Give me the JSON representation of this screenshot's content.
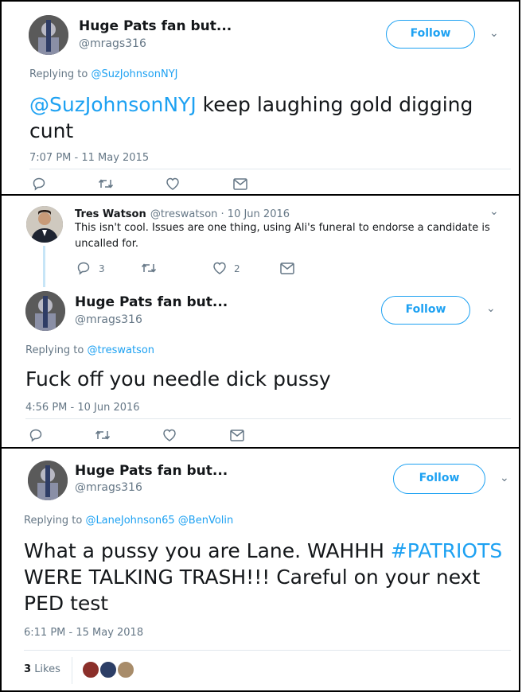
{
  "tweet1": {
    "user": {
      "name": "Huge Pats fan but...",
      "handle": "@mrags316"
    },
    "follow_label": "Follow",
    "reply_prefix": "Replying to",
    "reply_to": "@SuzJohnsonNYJ",
    "text_mention": "@SuzJohnsonNYJ",
    "text_rest": " keep laughing gold digging cunt",
    "timestamp": "7:07 PM - 11 May 2015"
  },
  "tweet2_parent": {
    "name": "Tres Watson",
    "handle_date": "@treswatson · 10 Jun 2016",
    "text": "This isn't cool. Issues are one thing, using Ali's funeral to endorse a candidate is uncalled for.",
    "reply_count": "3",
    "like_count": "2"
  },
  "tweet2": {
    "user": {
      "name": "Huge Pats fan but...",
      "handle": "@mrags316"
    },
    "follow_label": "Follow",
    "reply_prefix": "Replying to",
    "reply_to": "@treswatson",
    "text": "Fuck off you needle dick pussy",
    "timestamp": "4:56 PM - 10 Jun 2016"
  },
  "tweet3": {
    "user": {
      "name": "Huge Pats fan but...",
      "handle": "@mrags316"
    },
    "follow_label": "Follow",
    "reply_prefix": "Replying to",
    "reply_to": "@LaneJohnson65 @BenVolin",
    "text_start": "What a pussy you are Lane. WAHHH ",
    "hashtag": "#PATRIOTS",
    "text_end": " WERE TALKING TRASH!!! Careful on your next PED test",
    "timestamp": "6:11 PM - 15 May 2018",
    "likes_count": "3",
    "likes_label": "Likes"
  },
  "colors": {
    "accent": "#1da1f2",
    "muted": "#657786",
    "text": "#14171a"
  }
}
